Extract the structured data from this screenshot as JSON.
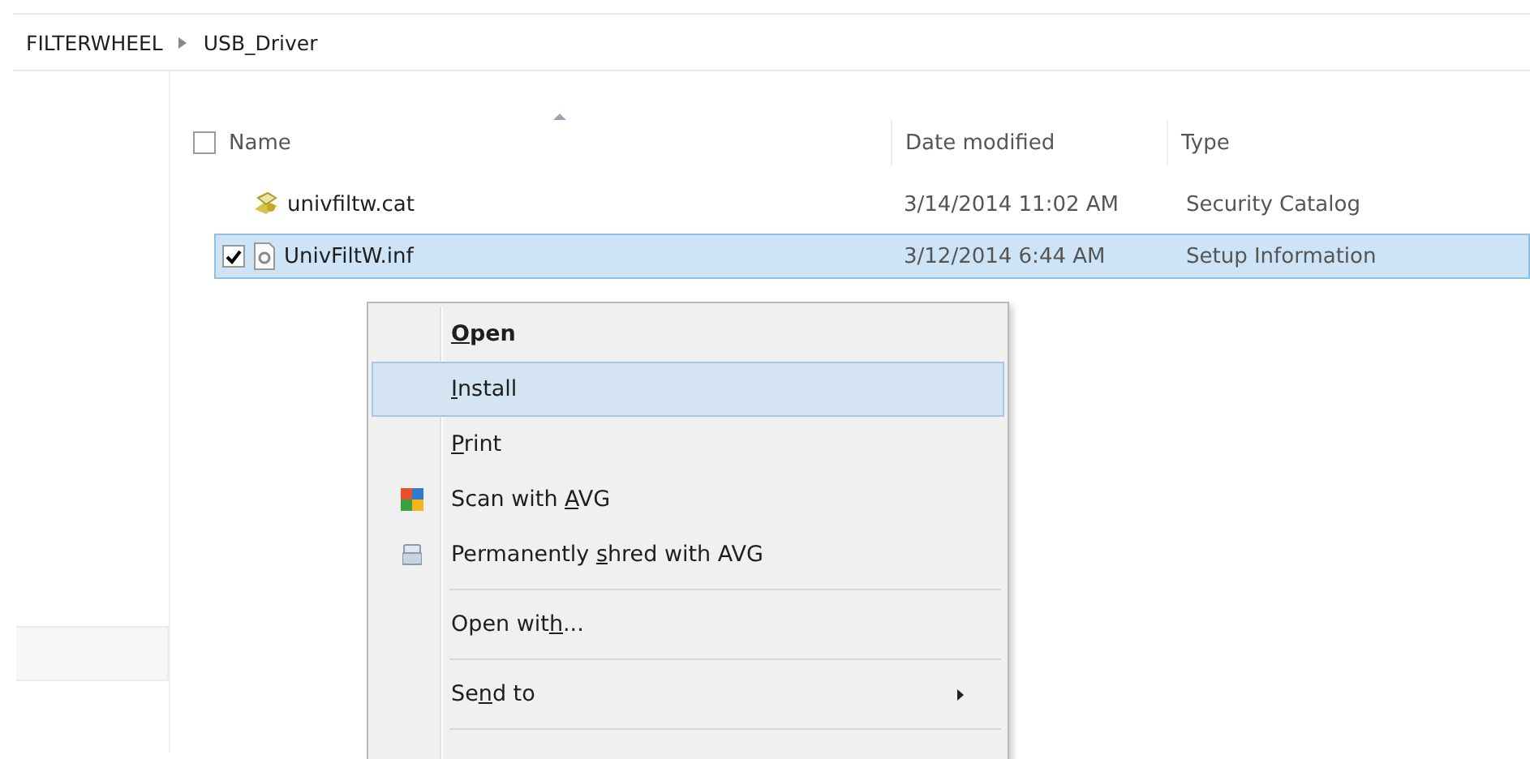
{
  "breadcrumb": [
    "FILTERWHEEL",
    "USB_Driver"
  ],
  "header_checkbox": {
    "checked": false
  },
  "columns": [
    {
      "label": "Name",
      "sorted": true
    },
    {
      "label": "Date modified",
      "sorted": false
    },
    {
      "label": "Type",
      "sorted": false
    }
  ],
  "files": [
    {
      "name": "univfiltw.cat",
      "date": "3/14/2014 11:02 AM",
      "type": "Security Catalog",
      "kind": "catalog",
      "selected": false,
      "checked": false
    },
    {
      "name": "UnivFiltW.inf",
      "date": "3/12/2014 6:44 AM",
      "type": "Setup Information",
      "kind": "setup",
      "selected": true,
      "checked": true
    }
  ],
  "menu": [
    {
      "kind": "item",
      "key": "O",
      "after": "pen",
      "bold": true,
      "selected": false
    },
    {
      "kind": "item",
      "key": "I",
      "after": "nstall",
      "bold": false,
      "selected": true
    },
    {
      "kind": "item",
      "key": "P",
      "after": "rint",
      "bold": false,
      "selected": false
    },
    {
      "kind": "scan",
      "before": "Scan with ",
      "key": "A",
      "after": "VG",
      "bold": false,
      "selected": false
    },
    {
      "kind": "shred",
      "before": "Permanently ",
      "key": "s",
      "after": "hred with AVG",
      "bold": false,
      "selected": false
    },
    {
      "kind": "separator"
    },
    {
      "kind": "item",
      "before": "Open wit",
      "key": "h",
      "after": "...",
      "bold": false,
      "selected": false
    },
    {
      "kind": "separator"
    },
    {
      "kind": "submenu",
      "before": "Se",
      "key": "n",
      "after": "d to",
      "bold": false,
      "selected": false
    },
    {
      "kind": "separator"
    }
  ]
}
